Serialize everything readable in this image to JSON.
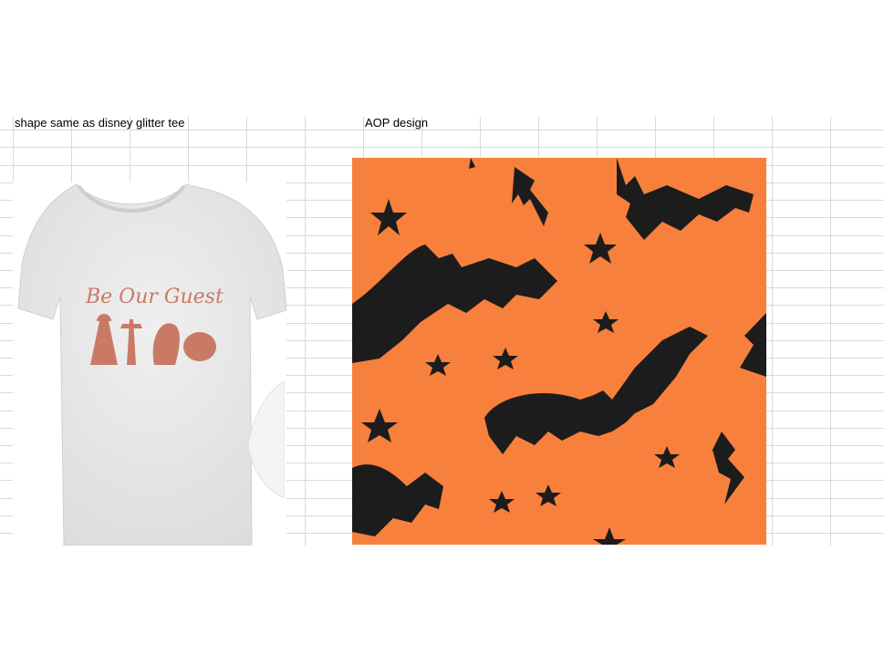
{
  "sheet": {
    "cell_tee_note": "shape same as disney glitter tee",
    "cell_aop_note": "AOP design"
  },
  "tee": {
    "print_text": "Be Our Guest",
    "tee_color": "#e9e9e9",
    "print_color": "#c97a66"
  },
  "aop": {
    "background_color": "#f7803d",
    "motif_color": "#1c1c1c",
    "motifs": [
      "bat-icon",
      "star-icon",
      "lightning-bolt-icon"
    ]
  }
}
